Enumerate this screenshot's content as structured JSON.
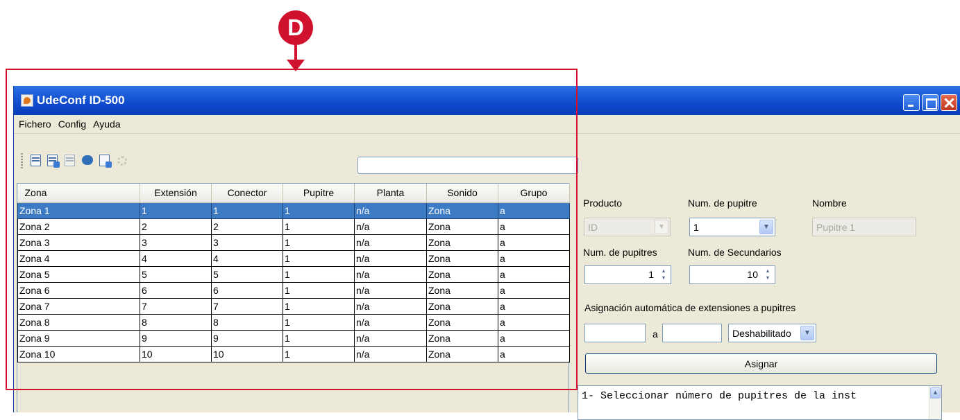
{
  "callout": {
    "letter": "D",
    "color": "#d1122f"
  },
  "window": {
    "title": "UdeConf ID-500"
  },
  "menu": [
    "Fichero",
    "Config",
    "Ayuda"
  ],
  "toolbar": {
    "icons": [
      "save-icon",
      "import-icon",
      "export-icon",
      "transfer-icon",
      "windows-icon",
      "settings-icon"
    ],
    "search_value": ""
  },
  "table": {
    "headers": [
      "Zona",
      "Extensión",
      "Conector",
      "Pupitre",
      "Planta",
      "Sonido",
      "Grupo"
    ],
    "rows": [
      [
        "Zona 1",
        "1",
        "1",
        "1",
        "n/a",
        "Zona",
        "a"
      ],
      [
        "Zona 2",
        "2",
        "2",
        "1",
        "n/a",
        "Zona",
        "a"
      ],
      [
        "Zona 3",
        "3",
        "3",
        "1",
        "n/a",
        "Zona",
        "a"
      ],
      [
        "Zona 4",
        "4",
        "4",
        "1",
        "n/a",
        "Zona",
        "a"
      ],
      [
        "Zona 5",
        "5",
        "5",
        "1",
        "n/a",
        "Zona",
        "a"
      ],
      [
        "Zona 6",
        "6",
        "6",
        "1",
        "n/a",
        "Zona",
        "a"
      ],
      [
        "Zona 7",
        "7",
        "7",
        "1",
        "n/a",
        "Zona",
        "a"
      ],
      [
        "Zona 8",
        "8",
        "8",
        "1",
        "n/a",
        "Zona",
        "a"
      ],
      [
        "Zona 9",
        "9",
        "9",
        "1",
        "n/a",
        "Zona",
        "a"
      ],
      [
        "Zona 10",
        "10",
        "10",
        "1",
        "n/a",
        "Zona",
        "a"
      ]
    ],
    "selected_row": 0,
    "selection_color": "#3d7bc5"
  },
  "panel": {
    "producto_label": "Producto",
    "producto_value": "ID",
    "num_pupitre_label": "Num. de pupitre",
    "num_pupitre_value": "1",
    "nombre_label": "Nombre",
    "nombre_placeholder": "Pupitre 1",
    "num_pupitres_label": "Num. de pupitres",
    "num_pupitres_value": "1",
    "num_secundarios_label": "Num. de Secundarios",
    "num_secundarios_value": "10",
    "asignacion_label": "Asignación automática de extensiones a pupitres",
    "range_from": "",
    "range_separator": "a",
    "range_to": "",
    "mode_value": "Deshabilitado",
    "asignar_label": "Asignar",
    "help_text": "1- Seleccionar número de pupitres de la inst"
  }
}
